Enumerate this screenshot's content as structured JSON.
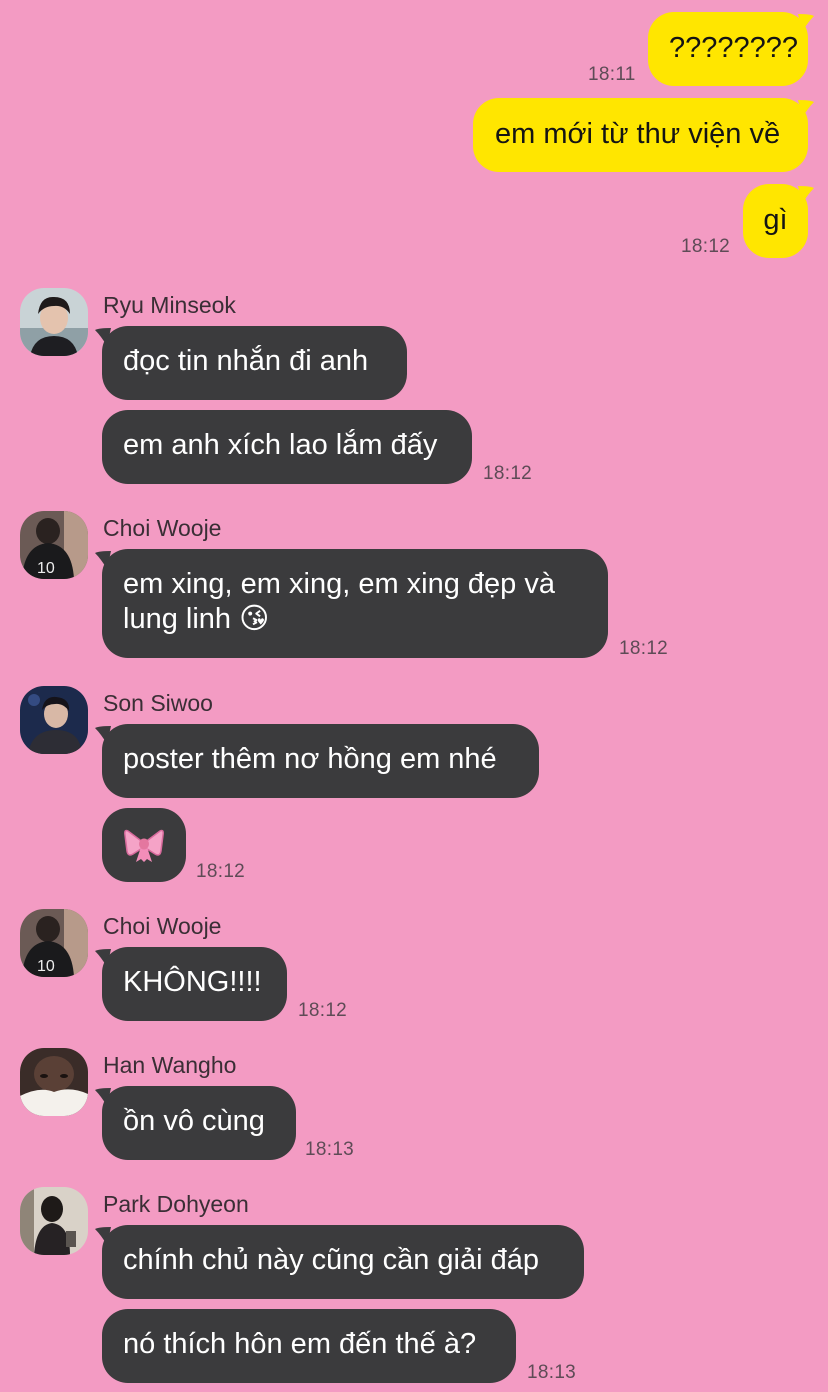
{
  "outgoing": [
    {
      "text": "????????",
      "time": "18:11"
    },
    {
      "text": "em mới từ thư viện về",
      "time": ""
    },
    {
      "text": "gì",
      "time": "18:12"
    }
  ],
  "groups": [
    {
      "sender": "Ryu Minseok",
      "avatar_icon": "profile-photo-avatar",
      "messages": [
        {
          "text": "đọc tin nhắn đi anh",
          "time": ""
        },
        {
          "text": "em anh xích lao lắm đấy",
          "time": "18:12"
        }
      ]
    },
    {
      "sender": "Choi Wooje",
      "avatar_icon": "profile-photo-avatar",
      "messages": [
        {
          "text": "em xing, em xing, em xing đẹp và lung linh 😘",
          "time": "18:12"
        }
      ]
    },
    {
      "sender": "Son Siwoo",
      "avatar_icon": "profile-photo-avatar",
      "messages": [
        {
          "text": "poster thêm nơ hồng em nhé",
          "time": ""
        },
        {
          "text": "ribbon-emoji",
          "time": "18:12"
        }
      ]
    },
    {
      "sender": "Choi Wooje",
      "avatar_icon": "profile-photo-avatar",
      "messages": [
        {
          "text": "KHÔNG!!!!",
          "time": "18:12"
        }
      ]
    },
    {
      "sender": "Han Wangho",
      "avatar_icon": "profile-photo-avatar",
      "messages": [
        {
          "text": "ồn vô cùng",
          "time": "18:13"
        }
      ]
    },
    {
      "sender": "Park Dohyeon",
      "avatar_icon": "profile-photo-avatar",
      "messages": [
        {
          "text": "chính chủ này cũng cần giải đáp",
          "time": ""
        },
        {
          "text": "nó thích hôn em đến thế à?",
          "time": "18:13"
        }
      ]
    }
  ],
  "colors": {
    "background": "#F39BC3",
    "outgoing_bubble": "#FFE600",
    "incoming_bubble": "#3B3B3D"
  }
}
